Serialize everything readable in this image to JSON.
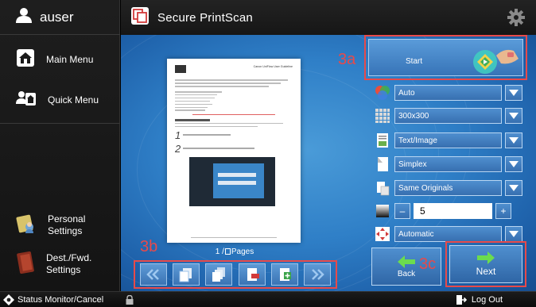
{
  "sidebar": {
    "user_name": "auser",
    "items": [
      {
        "label": "Main Menu"
      },
      {
        "label": "Quick Menu"
      },
      {
        "label": "Personal\nSettings"
      },
      {
        "label": "Dest./Fwd.\nSettings"
      }
    ]
  },
  "header": {
    "title": "Secure PrintScan"
  },
  "preview": {
    "doc_title": "Canon UniFlow User Guideline"
  },
  "pagination": {
    "current": "1",
    "pages_label": "Pages"
  },
  "start": {
    "label": "Start"
  },
  "settings": {
    "color_mode": "Auto",
    "resolution": "300x300",
    "original_type": "Text/Image",
    "sides": "Simplex",
    "original_size": "Same Originals",
    "density": "5",
    "orientation": "Automatic"
  },
  "actions": {
    "back_label": "Back",
    "next_label": "Next"
  },
  "annotations": {
    "start": "3a",
    "nav": "3b",
    "next": "3c"
  },
  "status_bar": {
    "status_label": "Status Monitor/Cancel",
    "logout_label": "Log Out"
  }
}
